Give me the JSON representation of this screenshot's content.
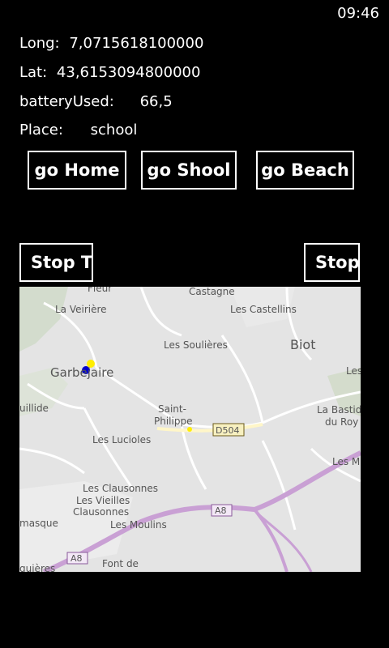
{
  "status": {
    "time": "09:46"
  },
  "info": {
    "long_label": "Long:",
    "long_value": "7,0715618100000",
    "lat_label": "Lat:",
    "lat_value": "43,6153094800000",
    "battery_label": "batteryUsed:",
    "battery_value": "66,5",
    "place_label": "Place:",
    "place_value": "school"
  },
  "buttons": {
    "go_home": "go Home",
    "go_school": "go Shool",
    "go_beach": "go Beach",
    "stop_left": "Stop T",
    "stop_right": "Stop"
  },
  "map": {
    "labels": {
      "fleur": "Fleur",
      "castagne": "Castagne",
      "la_veiriere": "La Veirière",
      "les_castellins": "Les Castellins",
      "les_soulieres": "Les Soulières",
      "biot": "Biot",
      "garbejaire": "Garbejaire",
      "les": "Les",
      "uillide": "uillide",
      "saint": "Saint-",
      "philippe": "Philippe",
      "d504": "D504",
      "la_bastide": "La Bastid",
      "du_roy": "du Roy",
      "les_lucioles": "Les Lucioles",
      "les_m": "Les M",
      "les_clausonnes": "Les Clausonnes",
      "les_vieilles": "Les Vieilles",
      "clausonnes": "Clausonnes",
      "a8_right": "A8",
      "masque": "masque",
      "les_moulins": "Les Moulins",
      "a8_left": "A8",
      "font_de": "Font de",
      "guieres": "guières"
    },
    "colors": {
      "road_major": "#c9a0d4",
      "location_dot": "#0000cc",
      "marker_yellow": "#ffee00"
    }
  }
}
